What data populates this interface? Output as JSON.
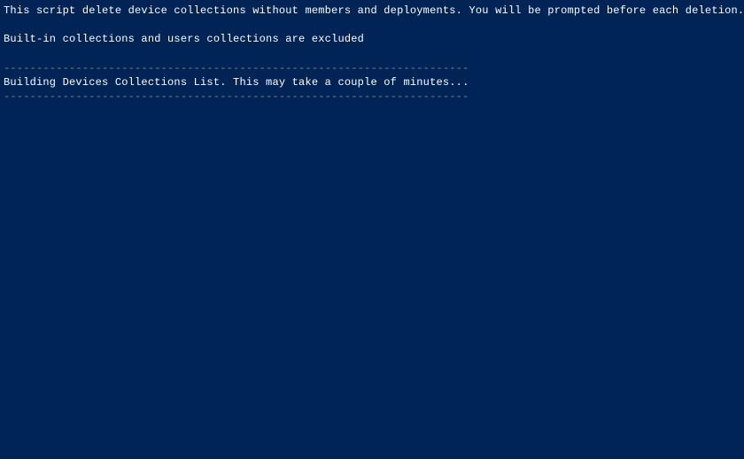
{
  "console": {
    "line1": "This script delete device collections without members and deployments. You will be prompted before each deletion.",
    "line2": "",
    "line3": "Built-in collections and users collections are excluded",
    "line4": "",
    "separator1": "-----------------------------------------------------------------------",
    "line5": "Building Devices Collections List. This may take a couple of minutes...",
    "separator2": "-----------------------------------------------------------------------"
  }
}
